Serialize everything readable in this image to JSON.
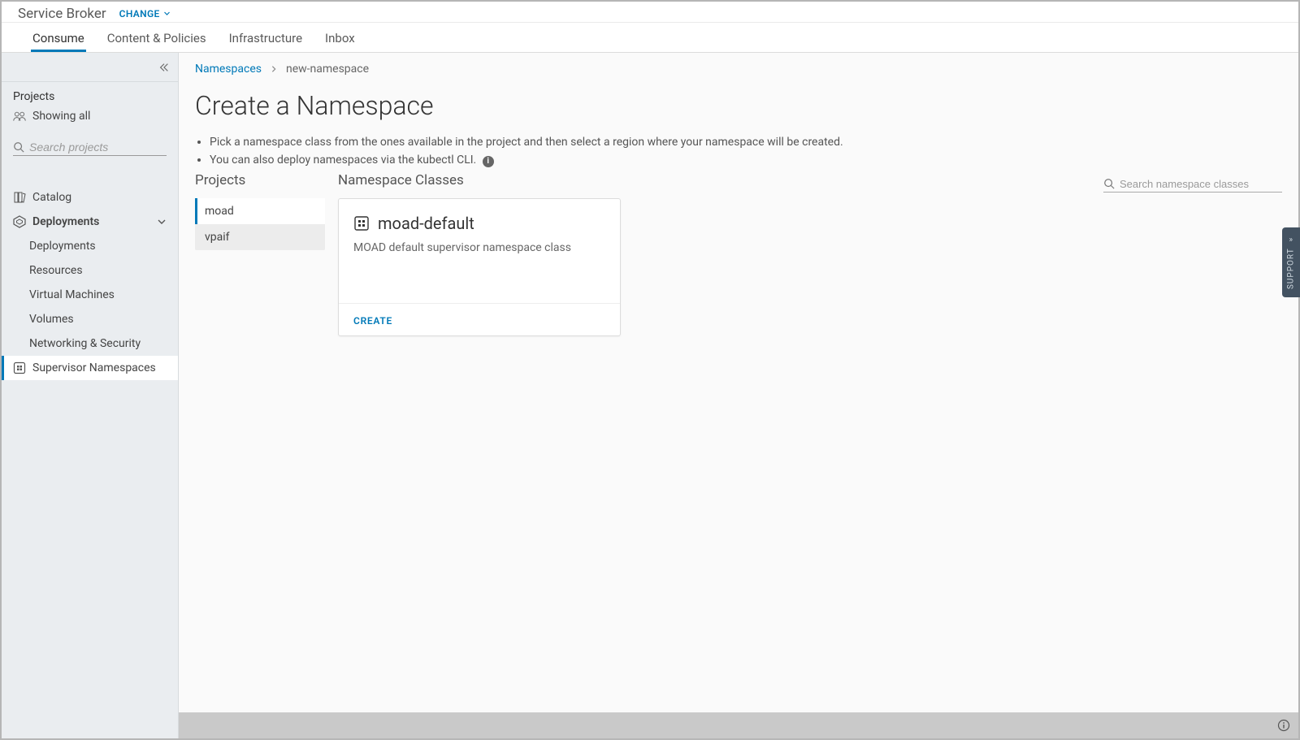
{
  "brand": {
    "title": "Service Broker",
    "change_label": "CHANGE"
  },
  "topnav": {
    "tabs": [
      {
        "label": "Consume",
        "active": true
      },
      {
        "label": "Content & Policies"
      },
      {
        "label": "Infrastructure"
      },
      {
        "label": "Inbox"
      }
    ]
  },
  "sidebar": {
    "projects_heading": "Projects",
    "showing_all": "Showing all",
    "search_placeholder": "Search projects",
    "nav": {
      "catalog": "Catalog",
      "deployments": "Deployments",
      "deployments_sub": "Deployments",
      "resources": "Resources",
      "vms": "Virtual Machines",
      "volumes": "Volumes",
      "network": "Networking & Security",
      "supervisor": "Supervisor Namespaces"
    }
  },
  "breadcrumb": {
    "root": "Namespaces",
    "current": "new-namespace"
  },
  "page": {
    "title": "Create a Namespace",
    "bullets": [
      "Pick a namespace class from the ones available in the project and then select a region where your namespace will be created.",
      "You can also deploy namespaces via the kubectl CLI."
    ]
  },
  "projects": {
    "heading": "Projects",
    "items": [
      {
        "label": "moad",
        "active": true
      },
      {
        "label": "vpaif"
      }
    ]
  },
  "classes": {
    "heading": "Namespace Classes",
    "search_placeholder": "Search namespace classes",
    "cards": [
      {
        "title": "moad-default",
        "subtitle": "MOAD default supervisor namespace class",
        "action": "CREATE"
      }
    ]
  },
  "support_label": "SUPPORT"
}
